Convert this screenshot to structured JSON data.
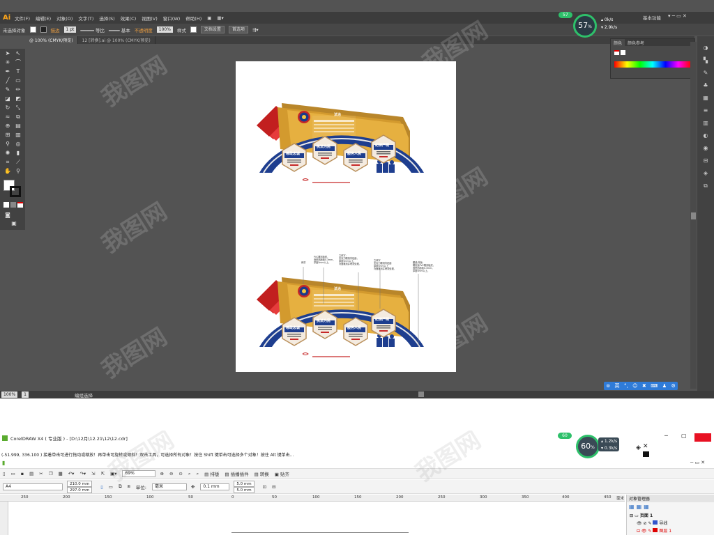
{
  "illustrator": {
    "logo": "Ai",
    "menu": [
      "文件(F)",
      "编辑(E)",
      "对象(O)",
      "文字(T)",
      "选择(S)",
      "效果(C)",
      "视图(V)",
      "窗口(W)",
      "帮助(H)"
    ],
    "workspace": "基本功能",
    "control": {
      "selection": "未选择对象",
      "stroke_label": "描边",
      "stroke_value": "1 pt",
      "profile": "等比",
      "brush": "基本",
      "opacity_label": "不透明度",
      "opacity_value": "100%",
      "style_label": "样式",
      "doc_setup": "文档设置",
      "prefs": "首选项"
    },
    "tabs": [
      {
        "label": "@ 100% (CMYK/预览)",
        "active": true
      },
      {
        "label": "12 [转换].ai @ 100% (CMYK/预览)",
        "active": false
      }
    ],
    "color_panel": {
      "tabs": [
        "颜色",
        "颜色参考"
      ]
    },
    "status": {
      "zoom": "100%",
      "page": "1",
      "tool": "编组选择"
    },
    "ime": {
      "label": "英"
    },
    "gauge": {
      "percent": "57",
      "unit": "%",
      "up": "0k/s",
      "down": "2.9k/s",
      "badge": "57"
    }
  },
  "artwork": {
    "top_title": "法治",
    "hexes": [
      "尊政忠诚",
      "执法为民",
      "服务人民",
      "纪律严明"
    ],
    "annotations": [
      {
        "text": "烤漆"
      },
      {
        "text": "PVC雕刻板底，\n造型贴面板0.3mm，\n厚度5mm以上。"
      },
      {
        "text": "立体字：\n亚克力雕刻背贴面，\n厚度5mm以上，\n背面雕刻并喷漆处理。"
      },
      {
        "text": "立体字\n亚克力雕刻背贴面\n厚度5mm以上\n背面雕刻并喷漆处理。"
      },
      {
        "text": "腰线/背板：\n雕刻及PVC雕刻板底，\n造型贴面板0.3mm，\n厚度5mm以上。"
      }
    ]
  },
  "coreldraw": {
    "title": "CorelDRAW X4 ( 专业版 ) - [D:\\12月\\12.21\\12\\12.cdr]",
    "status_text": "(-51.999, 336.100 )     接着单击可进行拖动或缩放！再单击可旋转或倾斜！双击工具，可选择所有对象！按住 Shift 键单击可选择多个对象！按住 Alt 键单击...",
    "menus": [
      "排版",
      "插播插件",
      "转换",
      "贴齐"
    ],
    "page_size": "A4",
    "width": "210.0 mm",
    "height": "297.0 mm",
    "zoom": "69%",
    "units_label": "单位:",
    "units": "毫米",
    "nudge": "0.1 mm",
    "dup_x": "5.0 mm",
    "dup_y": "5.0 mm",
    "ruler_ticks": [
      "250",
      "200",
      "150",
      "100",
      "50",
      "0",
      "50",
      "100",
      "150",
      "200",
      "250",
      "300",
      "350",
      "400",
      "450"
    ],
    "ruler_unit": "毫米",
    "object_manager": {
      "title": "对象管理器",
      "page": "页面 1",
      "layers": [
        {
          "name": "导线",
          "color": "#3355cc"
        },
        {
          "name": "图层 1",
          "color": "#dd0000"
        }
      ]
    },
    "gauge": {
      "percent": "60",
      "unit": "%",
      "up": "1.2k/s",
      "down": "0.3k/s",
      "badge": "60"
    }
  },
  "watermark": "我图网"
}
